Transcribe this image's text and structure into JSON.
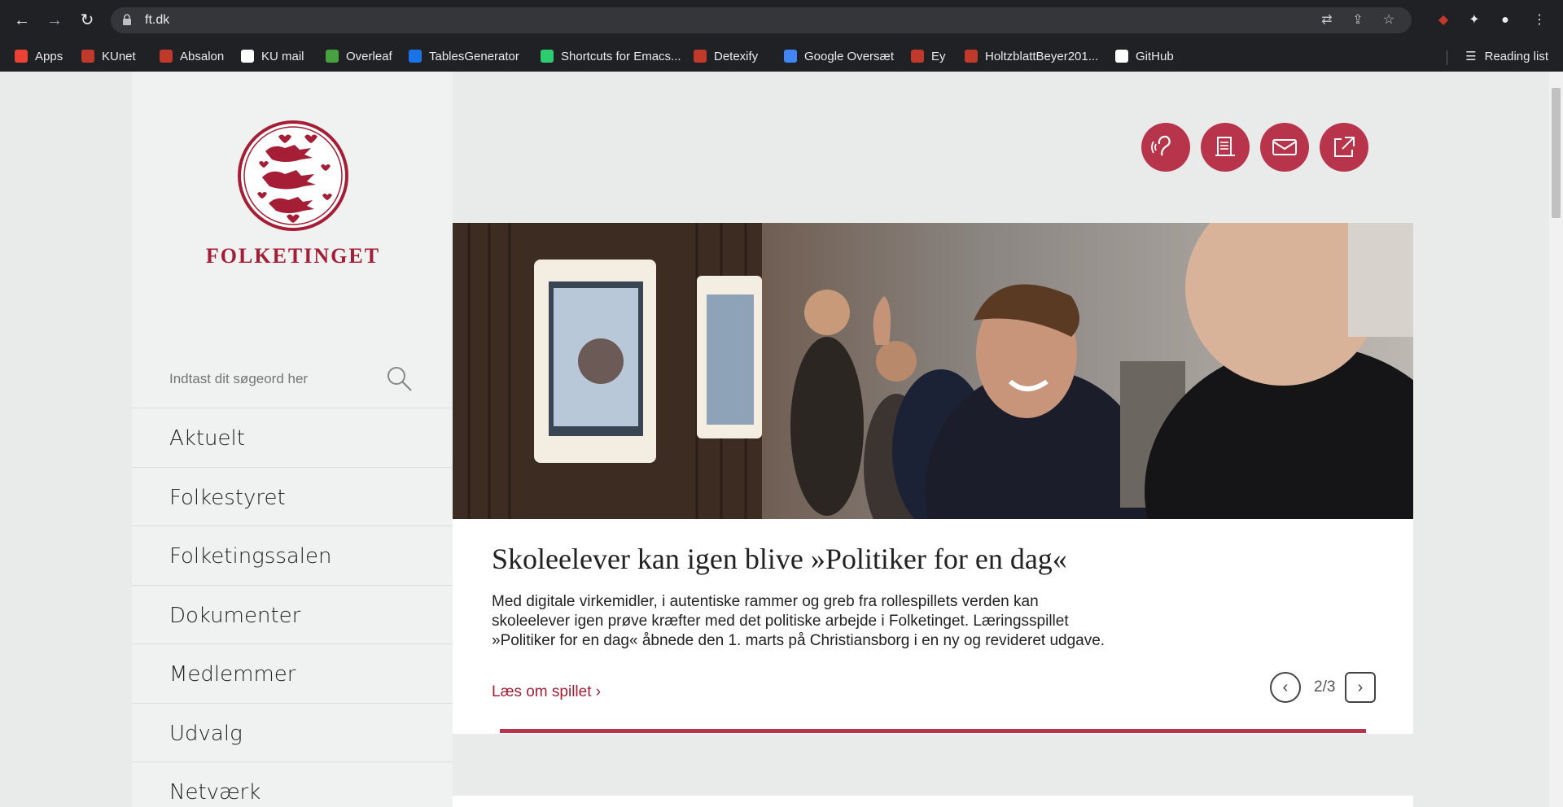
{
  "browser": {
    "url": "ft.dk",
    "bookmarks": [
      {
        "label": "Apps",
        "color": "#ea4335"
      },
      {
        "label": "KUnet",
        "color": "#c0392b"
      },
      {
        "label": "Absalon",
        "color": "#c0392b"
      },
      {
        "label": "KU mail",
        "color": "#ffffff"
      },
      {
        "label": "Overleaf",
        "color": "#47a141"
      },
      {
        "label": "TablesGenerator",
        "color": "#1a73e8"
      },
      {
        "label": "Shortcuts for Emacs...",
        "color": "#2ecc71"
      },
      {
        "label": "Detexify",
        "color": "#c0392b"
      },
      {
        "label": "Google Oversæt",
        "color": "#4285f4"
      },
      {
        "label": "Ey",
        "color": "#c0392b"
      },
      {
        "label": "HoltzblattBeyer201...",
        "color": "#c0392b"
      },
      {
        "label": "GitHub",
        "color": "#ffffff"
      }
    ],
    "reading_list": "Reading list"
  },
  "site": {
    "logo_text": "FOLKETINGET",
    "brand_color": "#a51e36",
    "search": {
      "placeholder": "Indtast dit søgeord her"
    },
    "menu": [
      {
        "label": "Aktuelt"
      },
      {
        "label": "Folkestyret"
      },
      {
        "label": "Folketingssalen"
      },
      {
        "label": "Dokumenter"
      },
      {
        "label": "Medlemmer"
      },
      {
        "label": "Udvalg"
      },
      {
        "label": "Netværk"
      }
    ],
    "action_icons": [
      "ear-icon",
      "document-icon",
      "mail-icon",
      "external-link-icon"
    ]
  },
  "featured": {
    "title": "Skoleelever kan igen blive »Politiker for en dag«",
    "body": "Med digitale virkemidler, i autentiske rammer og greb fra rollespillets verden kan skoleelever igen prøve kræfter med det politiske arbejde i Folketinget. Læringsspillet »Politiker for en dag« åbnede den 1. marts på Christiansborg i en ny og revideret udgave.",
    "link": "Læs om spillet ›",
    "pager": "2/3"
  }
}
